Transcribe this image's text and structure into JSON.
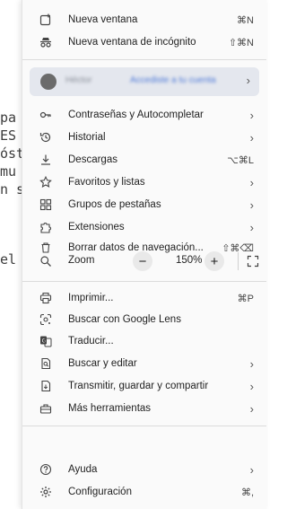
{
  "background": {
    "fragments": [
      "pa",
      "ES",
      "óst",
      "mu",
      "n s",
      "el"
    ]
  },
  "menu": {
    "new_window": {
      "label": "Nueva ventana",
      "shortcut": "⌘N"
    },
    "new_incognito": {
      "label": "Nueva ventana de incógnito",
      "shortcut": "⇧⌘N"
    },
    "profile": {
      "name": "Héctor",
      "status": "Accediste a tu cuenta"
    },
    "passwords": {
      "label": "Contraseñas y Autocompletar"
    },
    "history": {
      "label": "Historial"
    },
    "downloads": {
      "label": "Descargas",
      "shortcut": "⌥⌘L"
    },
    "bookmarks": {
      "label": "Favoritos y listas"
    },
    "tab_groups": {
      "label": "Grupos de pestañas"
    },
    "extensions": {
      "label": "Extensiones"
    },
    "clear_data": {
      "label": "Borrar datos de navegación...",
      "shortcut": "⇧⌘⌫"
    },
    "zoom": {
      "label": "Zoom",
      "value": "150%",
      "minus": "−",
      "plus": "+"
    },
    "print": {
      "label": "Imprimir...",
      "shortcut": "⌘P"
    },
    "lens": {
      "label": "Buscar con Google Lens"
    },
    "translate": {
      "label": "Traducir..."
    },
    "find_edit": {
      "label": "Buscar y editar"
    },
    "cast_save": {
      "label": "Transmitir, guardar y compartir"
    },
    "more_tools": {
      "label": "Más herramientas"
    },
    "help": {
      "label": "Ayuda"
    },
    "settings": {
      "label": "Configuración",
      "shortcut": "⌘,"
    },
    "chevron": "›"
  }
}
